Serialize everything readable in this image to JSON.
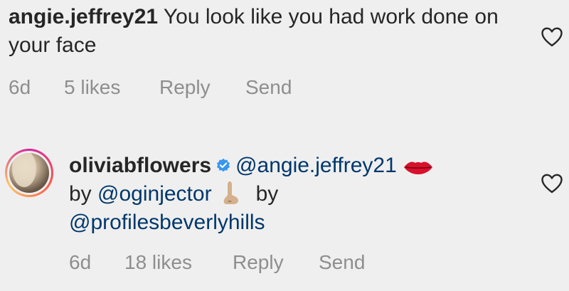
{
  "comments": [
    {
      "username": "angie.jeffrey21",
      "text": "You look like you had work done on your face",
      "time": "6d",
      "likes": "5 likes",
      "reply_label": "Reply",
      "send_label": "Send"
    },
    {
      "username": "oliviabflowers",
      "mention1": "@angie.jeffrey21",
      "by1": "by",
      "mention2": "@oginjector",
      "by2": "by",
      "mention3": "@profilesbeverlyhills",
      "time": "6d",
      "likes": "18 likes",
      "reply_label": "Reply",
      "send_label": "Send"
    }
  ],
  "icons": {
    "like": "heart-outline-icon",
    "verified": "verified-badge-icon",
    "lips_emoji": "lips-emoji",
    "nose_emoji": "nose-emoji"
  },
  "colors": {
    "background": "#efefef",
    "text": "#262626",
    "meta": "#8e8e8e",
    "mention": "#00376b",
    "verified": "#3897f0"
  }
}
